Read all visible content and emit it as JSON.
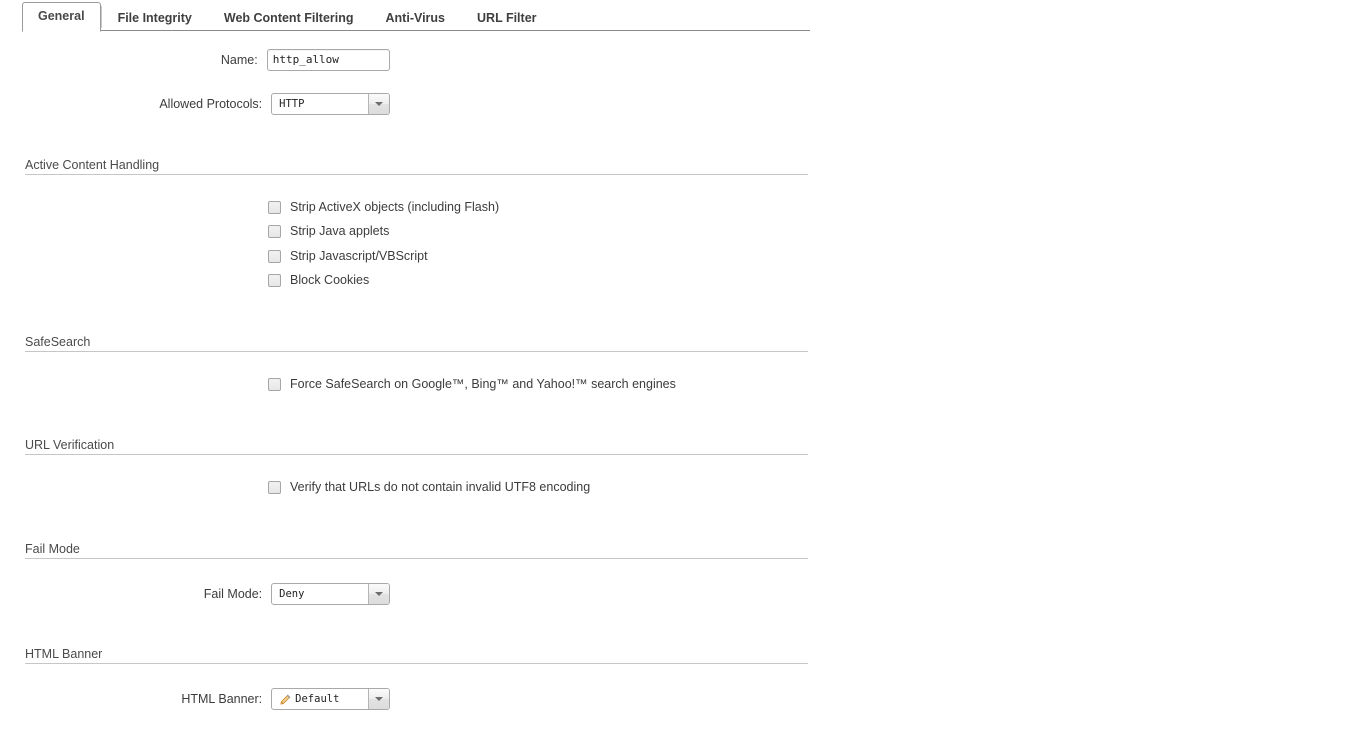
{
  "tabs": [
    {
      "label": "General",
      "active": true
    },
    {
      "label": "File Integrity",
      "active": false
    },
    {
      "label": "Web Content Filtering",
      "active": false
    },
    {
      "label": "Anti-Virus",
      "active": false
    },
    {
      "label": "URL Filter",
      "active": false
    }
  ],
  "fields": {
    "name": {
      "label": "Name:",
      "value": "http_allow"
    },
    "allowed_protocols": {
      "label": "Allowed Protocols:",
      "value": "HTTP"
    },
    "fail_mode": {
      "label": "Fail Mode:",
      "value": "Deny"
    },
    "html_banner": {
      "label": "HTML Banner:",
      "value": "Default"
    }
  },
  "sections": {
    "active_content": {
      "title": "Active Content Handling",
      "options": [
        {
          "label": "Strip ActiveX objects (including Flash)",
          "checked": false
        },
        {
          "label": "Strip Java applets",
          "checked": false
        },
        {
          "label": "Strip Javascript/VBScript",
          "checked": false
        },
        {
          "label": "Block Cookies",
          "checked": false
        }
      ]
    },
    "safesearch": {
      "title": "SafeSearch",
      "options": [
        {
          "label": "Force SafeSearch on Google™, Bing™ and Yahoo!™ search engines",
          "checked": false
        }
      ]
    },
    "url_verification": {
      "title": "URL Verification",
      "options": [
        {
          "label": "Verify that URLs do not contain invalid UTF8 encoding",
          "checked": false
        }
      ]
    },
    "fail_mode": {
      "title": "Fail Mode"
    },
    "html_banner": {
      "title": "HTML Banner"
    }
  },
  "colors": {
    "text": "#3c3c3c",
    "rule": "#c6c6c6",
    "border": "#a9a9a9",
    "pencil": "#e8a33d"
  }
}
